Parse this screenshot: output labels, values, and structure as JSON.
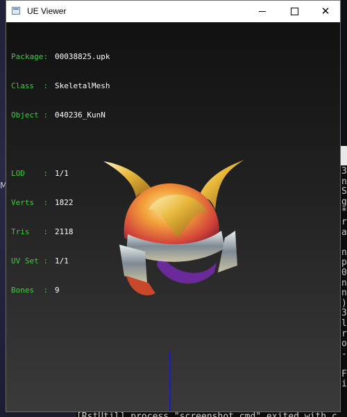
{
  "window": {
    "title": "UE Viewer"
  },
  "info": {
    "package_label": "Package:",
    "package_value": "00038825.upk",
    "class_label": "Class  :",
    "class_value": "SkeletalMesh",
    "object_label": "Object :",
    "object_value": "040236_KunN",
    "lod_label": "LOD    :",
    "lod_value": "1/1",
    "verts_label": "Verts  :",
    "verts_value": "1822",
    "tris_label": "Tris   :",
    "tris_value": "2118",
    "uvset_label": "UV Set :",
    "uvset_value": "1/1",
    "bones_label": "Bones  :",
    "bones_value": "9"
  },
  "background": {
    "left_glyph": "M",
    "console_chars": "3\nn\nS\ng\n*\nr\na\n\nn\np\n0\nn\nn\n)\n3\nl\nr\no\n-\n\nF\ni",
    "bottom_log": "[RstUtil] process \"screenshot.cmd\" exited with c"
  },
  "colors": {
    "label_green": "#34d334",
    "value_white": "#ffffff",
    "axis_blue": "#1c1cc8"
  },
  "icons": {
    "app": "app-window-icon",
    "minimize": "minimize-icon",
    "maximize": "maximize-icon",
    "close": "close-icon"
  }
}
